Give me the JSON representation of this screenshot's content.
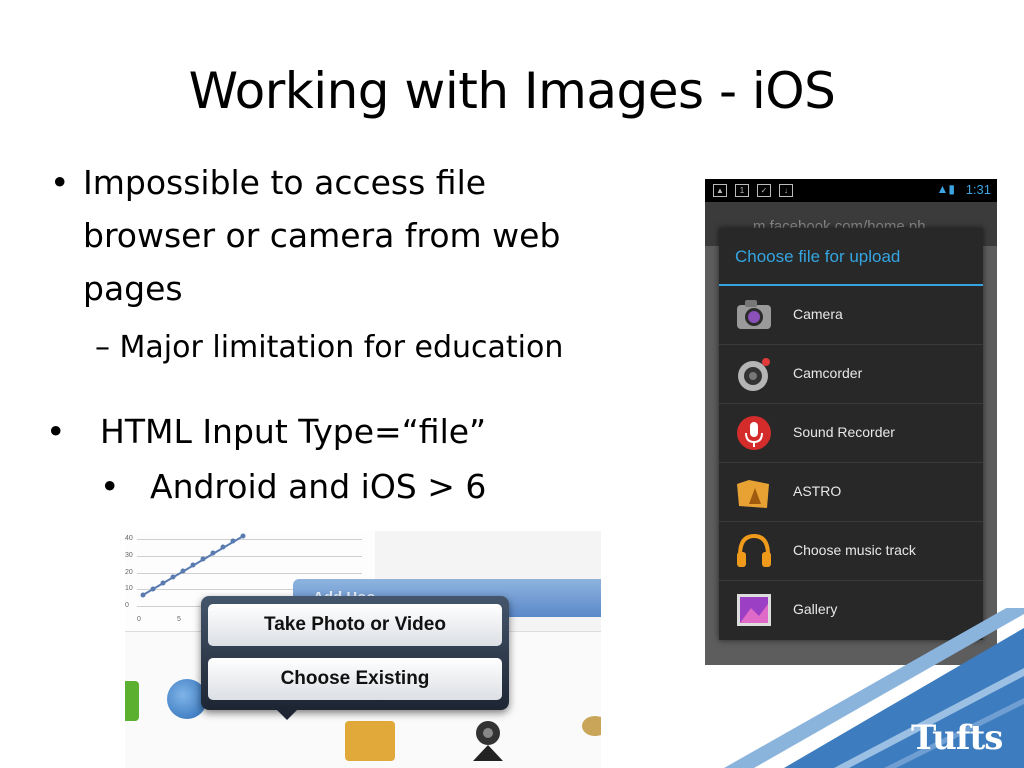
{
  "slide": {
    "title": "Working with Images - iOS",
    "bullet1": {
      "marker": "•",
      "lines": [
        "Impossible to access file",
        "browser or camera from web",
        "pages"
      ]
    },
    "sub_bullet": "– Major limitation for education",
    "bullet2": {
      "marker": "•",
      "text": "HTML Input Type=“file”"
    },
    "bullet3": {
      "marker": "•",
      "text": "Android and iOS > 6"
    },
    "logo": "Tufts"
  },
  "ios_screenshot": {
    "tick_labels": [
      "0",
      "5",
      "10",
      "20",
      "30",
      "40"
    ],
    "background_bar": "Add Hoo",
    "buttons": [
      "Take Photo or Video",
      "Choose Existing"
    ]
  },
  "android_screenshot": {
    "status_time": "1:31",
    "url": "m.facebook.com/home.ph",
    "dialog_title": "Choose file for upload",
    "items": [
      {
        "label": "Camera",
        "icon": "camera-icon"
      },
      {
        "label": "Camcorder",
        "icon": "camcorder-icon"
      },
      {
        "label": "Sound Recorder",
        "icon": "microphone-icon"
      },
      {
        "label": "ASTRO",
        "icon": "folder-icon"
      },
      {
        "label": "Choose music track",
        "icon": "headphones-icon"
      },
      {
        "label": "Gallery",
        "icon": "gallery-icon"
      }
    ]
  },
  "colors": {
    "android_accent": "#34a5e0",
    "ios_button_panel": "#1d2533",
    "tufts_blue": "#3d7dbf"
  }
}
